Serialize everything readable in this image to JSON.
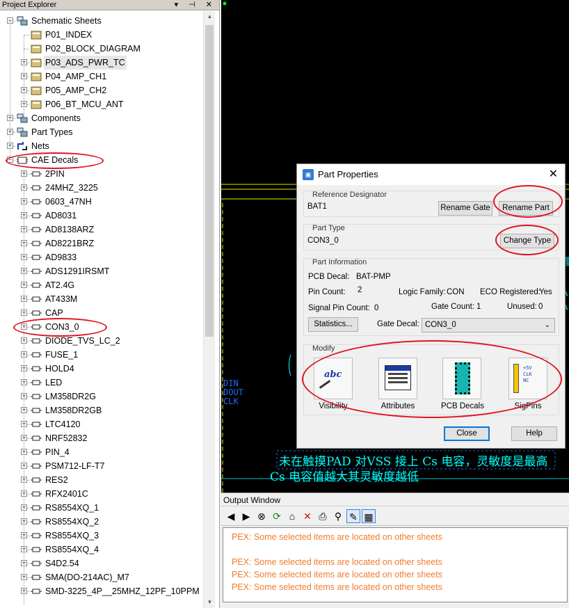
{
  "explorer": {
    "title": "Project Explorer",
    "title_buttons": "▾ ⊣ ✕",
    "tree": [
      {
        "label": "Schematic Sheets",
        "level": 0,
        "expander": "−",
        "icon": "schematic-sheets-icon"
      },
      {
        "label": "P01_INDEX",
        "level": 1,
        "expander": "",
        "icon": "sheet-icon"
      },
      {
        "label": "P02_BLOCK_DIAGRAM",
        "level": 1,
        "expander": "",
        "icon": "sheet-icon"
      },
      {
        "label": "P03_ADS_PWR_TC",
        "level": 1,
        "expander": "+",
        "icon": "sheet-icon"
      },
      {
        "label": "P04_AMP_CH1",
        "level": 1,
        "expander": "+",
        "icon": "sheet-icon"
      },
      {
        "label": "P05_AMP_CH2",
        "level": 1,
        "expander": "+",
        "icon": "sheet-icon"
      },
      {
        "label": "P06_BT_MCU_ANT",
        "level": 1,
        "expander": "+",
        "icon": "sheet-icon"
      },
      {
        "label": "Components",
        "level": 0,
        "expander": "+",
        "icon": "components-icon"
      },
      {
        "label": "Part Types",
        "level": 0,
        "expander": "+",
        "icon": "part-types-icon"
      },
      {
        "label": "Nets",
        "level": 0,
        "expander": "+",
        "icon": "nets-icon"
      },
      {
        "label": "CAE Decals",
        "level": 0,
        "expander": "−",
        "icon": "cae-decals-icon"
      },
      {
        "label": "2PIN",
        "level": 1,
        "expander": "+",
        "icon": "decal-icon"
      },
      {
        "label": "24MHZ_3225",
        "level": 1,
        "expander": "+",
        "icon": "decal-icon"
      },
      {
        "label": "0603_47NH",
        "level": 1,
        "expander": "+",
        "icon": "decal-icon"
      },
      {
        "label": "AD8031",
        "level": 1,
        "expander": "+",
        "icon": "decal-icon"
      },
      {
        "label": "AD8138ARZ",
        "level": 1,
        "expander": "+",
        "icon": "decal-icon"
      },
      {
        "label": "AD8221BRZ",
        "level": 1,
        "expander": "+",
        "icon": "decal-icon"
      },
      {
        "label": "AD9833",
        "level": 1,
        "expander": "+",
        "icon": "decal-icon"
      },
      {
        "label": "ADS1291IRSMT",
        "level": 1,
        "expander": "+",
        "icon": "decal-icon"
      },
      {
        "label": "AT2.4G",
        "level": 1,
        "expander": "+",
        "icon": "decal-icon"
      },
      {
        "label": "AT433M",
        "level": 1,
        "expander": "+",
        "icon": "decal-icon"
      },
      {
        "label": "CAP",
        "level": 1,
        "expander": "+",
        "icon": "decal-icon"
      },
      {
        "label": "CON3_0",
        "level": 1,
        "expander": "+",
        "icon": "decal-icon"
      },
      {
        "label": "DIODE_TVS_LC_2",
        "level": 1,
        "expander": "+",
        "icon": "decal-icon"
      },
      {
        "label": "FUSE_1",
        "level": 1,
        "expander": "+",
        "icon": "decal-icon"
      },
      {
        "label": "HOLD4",
        "level": 1,
        "expander": "+",
        "icon": "decal-icon"
      },
      {
        "label": "LED",
        "level": 1,
        "expander": "+",
        "icon": "decal-icon"
      },
      {
        "label": "LM358DR2G",
        "level": 1,
        "expander": "+",
        "icon": "decal-icon"
      },
      {
        "label": "LM358DR2GB",
        "level": 1,
        "expander": "+",
        "icon": "decal-icon"
      },
      {
        "label": "LTC4120",
        "level": 1,
        "expander": "+",
        "icon": "decal-icon"
      },
      {
        "label": "NRF52832",
        "level": 1,
        "expander": "+",
        "icon": "decal-icon"
      },
      {
        "label": "PIN_4",
        "level": 1,
        "expander": "+",
        "icon": "decal-icon"
      },
      {
        "label": "PSM712-LF-T7",
        "level": 1,
        "expander": "+",
        "icon": "decal-icon"
      },
      {
        "label": "RES2",
        "level": 1,
        "expander": "+",
        "icon": "decal-icon"
      },
      {
        "label": "RFX2401C",
        "level": 1,
        "expander": "+",
        "icon": "decal-icon"
      },
      {
        "label": "RS8554XQ_1",
        "level": 1,
        "expander": "+",
        "icon": "decal-icon"
      },
      {
        "label": "RS8554XQ_2",
        "level": 1,
        "expander": "+",
        "icon": "decal-icon"
      },
      {
        "label": "RS8554XQ_3",
        "level": 1,
        "expander": "+",
        "icon": "decal-icon"
      },
      {
        "label": "RS8554XQ_4",
        "level": 1,
        "expander": "+",
        "icon": "decal-icon"
      },
      {
        "label": "S4D2.54",
        "level": 1,
        "expander": "+",
        "icon": "decal-icon"
      },
      {
        "label": "SMA(DO-214AC)_M7",
        "level": 1,
        "expander": "+",
        "icon": "decal-icon"
      },
      {
        "label": "SMD-3225_4P__25MHZ_12PF_10PPM",
        "level": 1,
        "expander": "+",
        "icon": "decal-icon"
      }
    ]
  },
  "canvas": {
    "net_labels": [
      "DIN",
      "DOUT",
      "CLK"
    ],
    "chinese_line1": "未在触摸PAD 对VSS 接上 Cs 电容，灵敏度是最高",
    "chinese_line2": "Cs 电容值越大其灵敏度越低",
    "right_fragments": [
      "置",
      "A",
      "A"
    ]
  },
  "dialog": {
    "title": "Part Properties",
    "close": "✕",
    "app_icon": "part-properties-icon",
    "ref_designator": {
      "label": "Reference Designator",
      "value": "BAT1",
      "button": "Rename Gate",
      "button2": "Rename Part"
    },
    "part_type": {
      "label": "Part Type",
      "value": "CON3_0",
      "button": "Change Type"
    },
    "part_info": {
      "label": "Part Information",
      "pcb_decal_label": "PCB Decal:",
      "pcb_decal_value": "BAT-PMP",
      "pin_count_label": "Pin Count:",
      "pin_count_value": "2",
      "logic_family_label": "Logic Family:",
      "logic_family_value": "CON",
      "eco_label": "ECO Registered:",
      "eco_value": "Yes",
      "signal_pin_label": "Signal Pin Count:",
      "signal_pin_value": "0",
      "gate_count_label": "Gate Count:",
      "gate_count_value": "1",
      "unused_label": "Unused:",
      "unused_value": "0",
      "statistics_button": "Statistics...",
      "gate_decal_label": "Gate Decal:",
      "gate_decal_value": "CON3_0"
    },
    "modify": {
      "label": "Modify",
      "buttons": [
        {
          "label": "Visibility",
          "icon": "abc-visibility-icon",
          "glyph": "abc"
        },
        {
          "label": "Attributes",
          "icon": "attributes-icon"
        },
        {
          "label": "PCB Decals",
          "icon": "pcb-decal-chip-icon"
        },
        {
          "label": "SigPins",
          "icon": "sigpins-icon",
          "pins": [
            "+5V",
            "CLK",
            "NC"
          ]
        }
      ]
    },
    "close_button": "Close",
    "help_button": "Help"
  },
  "output": {
    "title": "Output Window",
    "toolbar": [
      {
        "icon": "back-arrow-icon",
        "glyph": "◀"
      },
      {
        "icon": "forward-arrow-icon",
        "glyph": "▶"
      },
      {
        "icon": "stop-icon",
        "glyph": "⊗"
      },
      {
        "icon": "refresh-icon",
        "glyph": "⟳"
      },
      {
        "icon": "home-icon",
        "glyph": "⌂"
      },
      {
        "icon": "delete-icon",
        "glyph": "✕"
      },
      {
        "icon": "print-icon",
        "glyph": "⎙"
      },
      {
        "icon": "find-binoculars-icon",
        "glyph": "⚲"
      },
      {
        "icon": "edit-pen-icon",
        "glyph": "✎"
      },
      {
        "icon": "table-grid-icon",
        "glyph": "▦"
      }
    ],
    "messages": [
      "PEX: Some selected items are located on other sheets",
      "",
      "PEX: Some selected items are located on other sheets",
      "PEX: Some selected items are located on other sheets",
      "PEX: Some selected items are located on other sheets"
    ]
  },
  "colors": {
    "annotation_red": "#e0141e",
    "message_orange": "#f07c2c",
    "canvas_bg": "#000000",
    "cyan_text": "#00ffff"
  }
}
